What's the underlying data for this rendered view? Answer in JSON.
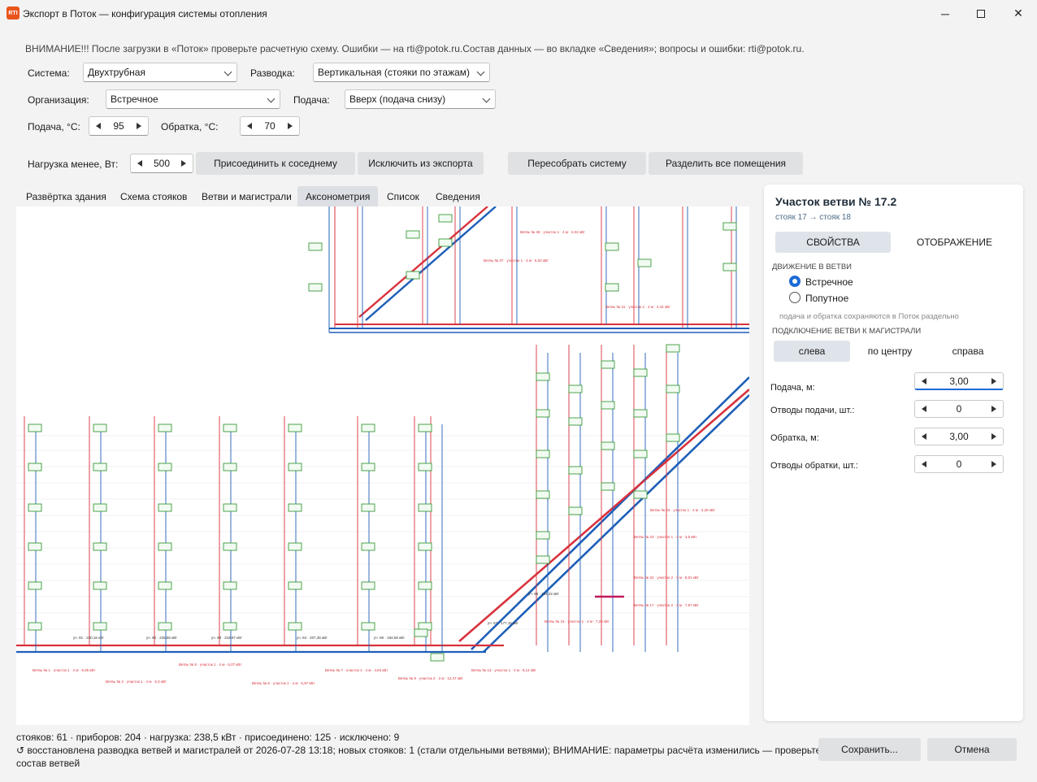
{
  "window": {
    "title": "Экспорт в Поток — конфигурация системы отопления",
    "logo_text": "RTI"
  },
  "warning": "ВНИМАНИЕ!!! После загрузки в «Поток» проверьте расчетную схему. Ошибки — на rti@potok.ru.Состав данных — во вкладке «Сведения»; вопросы и ошибки: rti@potok.ru.",
  "form": {
    "system_label": "Система:",
    "system_value": "Двухтрубная",
    "wiring_label": "Разводка:",
    "wiring_value": "Вертикальная (стояки по этажам)",
    "organization_label": "Организация:",
    "organization_value": "Встречное",
    "feed_label": "Подача:",
    "feed_value": "Вверх (подача снизу)",
    "supply_temp_label": "Подача, °С:",
    "supply_temp_value": "95",
    "return_temp_label": "Обратка, °С:",
    "return_temp_value": "70",
    "load_label": "Нагрузка менее, Вт:",
    "load_value": "500"
  },
  "actions": {
    "attach": "Присоединить к соседнему",
    "exclude": "Исключить из экспорта",
    "rebuild": "Пересобрать систему",
    "split": "Разделить все помещения"
  },
  "tabs": [
    {
      "label": "Развёртка здания"
    },
    {
      "label": "Схема стояков"
    },
    {
      "label": "Ветви и магистрали"
    },
    {
      "label": "Аксонометрия"
    },
    {
      "label": "Список"
    },
    {
      "label": "Сведения"
    }
  ],
  "panel": {
    "title": "Участок ветви № 17.2",
    "subtitle": "стояк 17 → стояк 18",
    "tab_props": "СВОЙСТВА",
    "tab_display": "ОТОБРАЖЕНИЕ",
    "movement_section": "ДВИЖЕНИЕ В ВЕТВИ",
    "radio_counter": "Встречное",
    "radio_passing": "Попутное",
    "note": "подача и обратка сохраняются в Поток раздельно",
    "connection_section": "ПОДКЛЮЧЕНИЕ ВЕТВИ К МАГИСТРАЛИ",
    "conn_left": "слева",
    "conn_center": "по центру",
    "conn_right": "справа",
    "supply_m_label": "Подача, м:",
    "supply_m_value": "3,00",
    "supply_taps_label": "Отводы подачи, шт.:",
    "supply_taps_value": "0",
    "return_m_label": "Обратка, м:",
    "return_m_value": "3,00",
    "return_taps_label": "Отводы обратки, шт.:",
    "return_taps_value": "0"
  },
  "status": {
    "line1": "стояков: 61 · приборов: 204 · нагрузка: 238,5 кВт · присоединено: 125 · исключено: 9",
    "line2": "↺ восстановлена разводка ветвей и магистралей от 2026-07-28 13:18; новых стояков: 1 (стали отдельными ветвями); ВНИМАНИЕ: параметры расчёта изменились — проверьте",
    "line3": "состав ветвей"
  },
  "footer": {
    "save": "Сохранить...",
    "cancel": "Отмена"
  },
  "colors": {
    "supply": "#d8323c",
    "return": "#1e5fb8",
    "device_border": "#3a9a3a",
    "accent": "#1c6bd6"
  },
  "diagram": {
    "bottom_section_labels": [
      "уч. 81 · 230,16 кВт",
      "уч. 82 · 225,66 кВт",
      "уч. 83 · 218,97 кВт",
      "уч. 84 · 207,36 кВт",
      "уч. 86 · 184,58 кВт",
      "уч. 87 · 177,15 кВт",
      "уч. 88 · 164,22 кВт"
    ],
    "bottom_branch_labels": [
      "Ветвь № 1 · участок 1 · 4 м · 8,36 кВт",
      "Ветвь № 2 · участок 1 · 4 м · 6,3 кВт",
      "Ветвь № 5 · участок 1 · 4 м · 6,07 кВт",
      "Ветвь № 6 · участок 1 · 4 м · 5,97 кВт",
      "Ветвь № 7 · участок 1 · 4 м · 4,84 кВт",
      "Ветвь № 9 · участок 2 · 3 м · 12,47 кВт",
      "Ветвь № 13 · участок 1 · 4 м · 9,14 кВт"
    ],
    "right_branch_labels": [
      "Ветвь № 15 · участок 1 · 4 м · 7,23 кВт",
      "Ветвь № 17 · участок 2 · 3 м · 7,87 кВт",
      "Ветвь № 22 · участок 2 · 3 м · 8,01 кВт",
      "Ветвь № 23 · участок 1 · 4 м · 3,5 кВт",
      "Ветвь № 24 · участок 1 · 4 м · 2,26 кВт"
    ],
    "top_branch_labels": [
      "Ветвь № 36 · участок 1 · 4 м · 2,02 кВт",
      "Ветвь № 37 · участок 1 · 4 м · 5,53 кВт",
      "Ветвь № 31 · участок 1 · 4 м · 2,44 кВт"
    ]
  }
}
